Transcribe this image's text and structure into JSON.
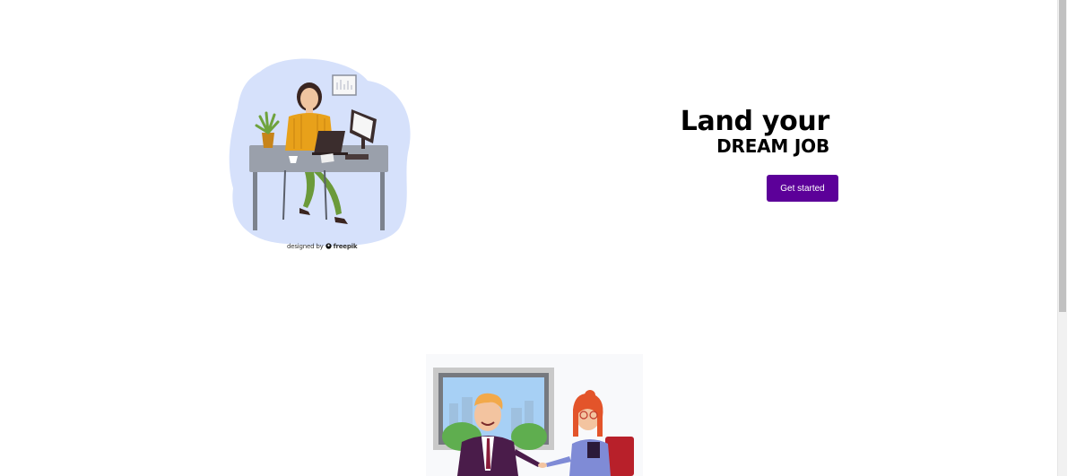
{
  "hero": {
    "title_line1": "Land your",
    "title_line2": "DREAM JOB",
    "cta_label": "Get started"
  },
  "illustration_credit": {
    "prefix": "designed by",
    "brand": "freepik"
  },
  "colors": {
    "cta_background": "#5c0099",
    "cta_text": "#ffffff",
    "blob": "#d6e1fb"
  },
  "icons": {
    "illustration_1": "woman-at-desk-illustration",
    "illustration_2": "handshake-meeting-illustration",
    "freepik_logo": "freepik-logo-icon"
  }
}
